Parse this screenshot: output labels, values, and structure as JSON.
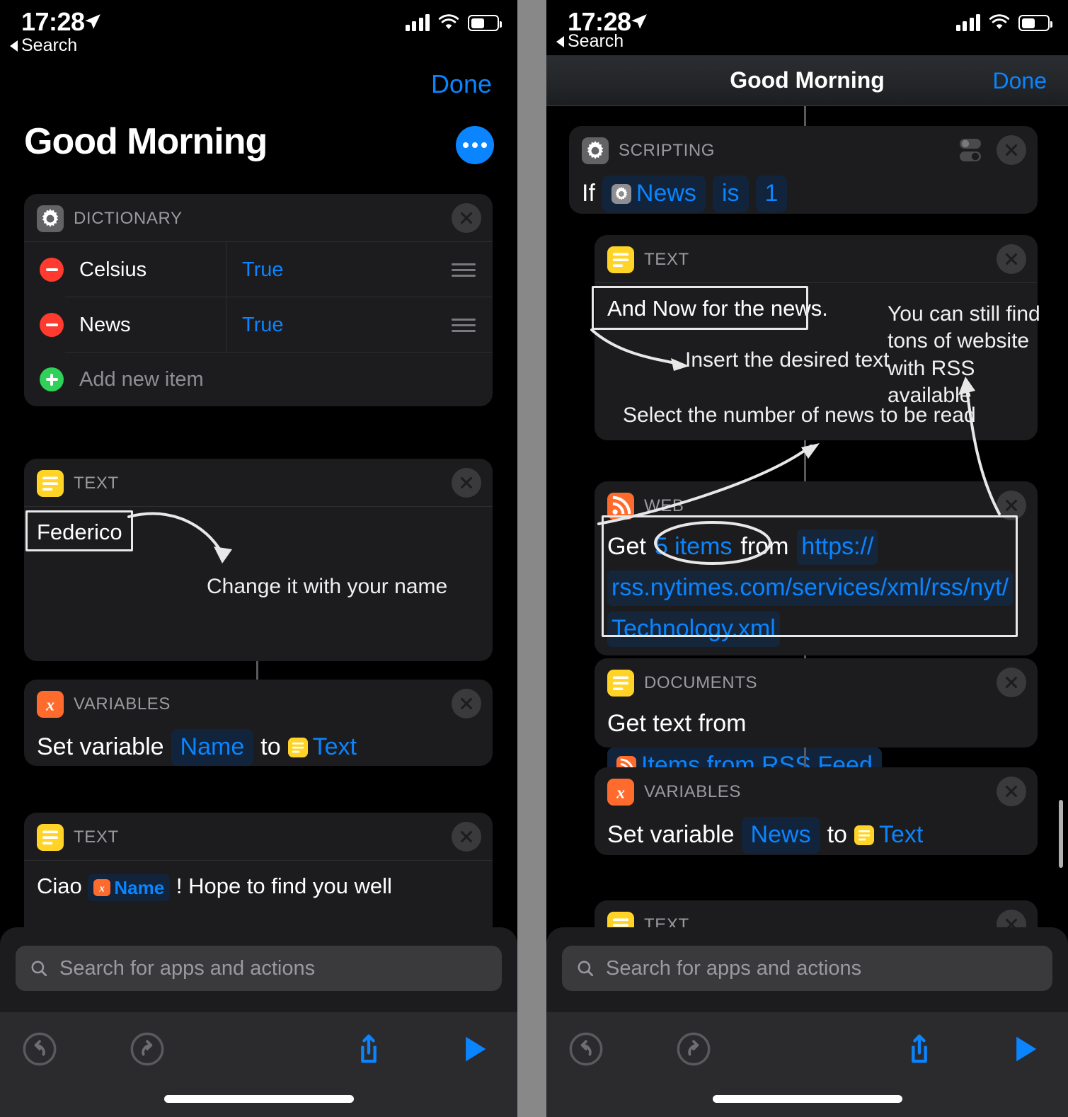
{
  "status_bar": {
    "time": "17:28",
    "back_label": "Search",
    "location_icon": "location-arrow-icon",
    "signal_icon": "cellular-bars-icon",
    "wifi_icon": "wifi-icon",
    "battery_icon": "battery-icon"
  },
  "left": {
    "done_label": "Done",
    "title": "Good Morning",
    "more_button": "more-ellipsis-button",
    "cards": {
      "dictionary": {
        "category": "DICTIONARY",
        "icon": "gear-icon",
        "rows": [
          {
            "key": "Celsius",
            "value": "True"
          },
          {
            "key": "News",
            "value": "True"
          }
        ],
        "add_label": "Add new item"
      },
      "text_name": {
        "category": "TEXT",
        "icon": "text-lines-icon",
        "value": "Federico",
        "annotation": "Change it with your name"
      },
      "variables_name": {
        "category": "VARIABLES",
        "icon": "x-variable-icon",
        "prefix": "Set variable",
        "variable": "Name",
        "middle": "to",
        "source": "Text"
      },
      "text_greeting": {
        "category": "TEXT",
        "icon": "text-lines-icon",
        "before": "Ciao",
        "variable": "Name",
        "after": "! Hope to find you well"
      }
    },
    "search_placeholder": "Search for apps and actions",
    "toolbar": {
      "undo": "undo-icon",
      "redo": "redo-icon",
      "share": "share-icon",
      "play": "play-icon"
    }
  },
  "right": {
    "title": "Good Morning",
    "done_label": "Done",
    "cards": {
      "scripting": {
        "category": "SCRIPTING",
        "icon": "gear-icon",
        "toggles_icon": "sliders-icon",
        "if_label": "If",
        "variable": "News",
        "operator": "is",
        "value": "1"
      },
      "text_news": {
        "category": "TEXT",
        "icon": "text-lines-icon",
        "value": "And Now for the news.",
        "annotation_insert": "Insert the desired text",
        "annotation_select": "Select the number of news to be read",
        "annotation_rss": "You can still find tons of website with RSS available"
      },
      "web": {
        "category": "WEB",
        "icon": "rss-icon",
        "get_label": "Get",
        "count": "5 items",
        "from_label": "from",
        "url_part1": "https://",
        "url_part2": "rss.nytimes.com/services/xml/rss/nyt/",
        "url_part3": "Technology.xml"
      },
      "documents": {
        "category": "DOCUMENTS",
        "icon": "text-lines-icon",
        "prefix": "Get text from",
        "source": "Items from RSS Feed"
      },
      "variables_news": {
        "category": "VARIABLES",
        "icon": "x-variable-icon",
        "prefix": "Set variable",
        "variable": "News",
        "middle": "to",
        "source": "Text"
      },
      "text_bottom": {
        "category": "TEXT",
        "icon": "text-lines-icon"
      }
    },
    "search_placeholder": "Search for apps and actions",
    "toolbar": {
      "undo": "undo-icon",
      "redo": "redo-icon",
      "share": "share-icon",
      "play": "play-icon"
    }
  },
  "colors": {
    "accent_blue": "#0a84ff",
    "card_bg": "#1c1c1e",
    "gear_gray": "#636366",
    "text_yellow": "#ffd426",
    "var_orange": "#ff6b2c",
    "rss_orange": "#ff6b2c",
    "minus_red": "#ff3b30",
    "plus_green": "#30d158"
  }
}
